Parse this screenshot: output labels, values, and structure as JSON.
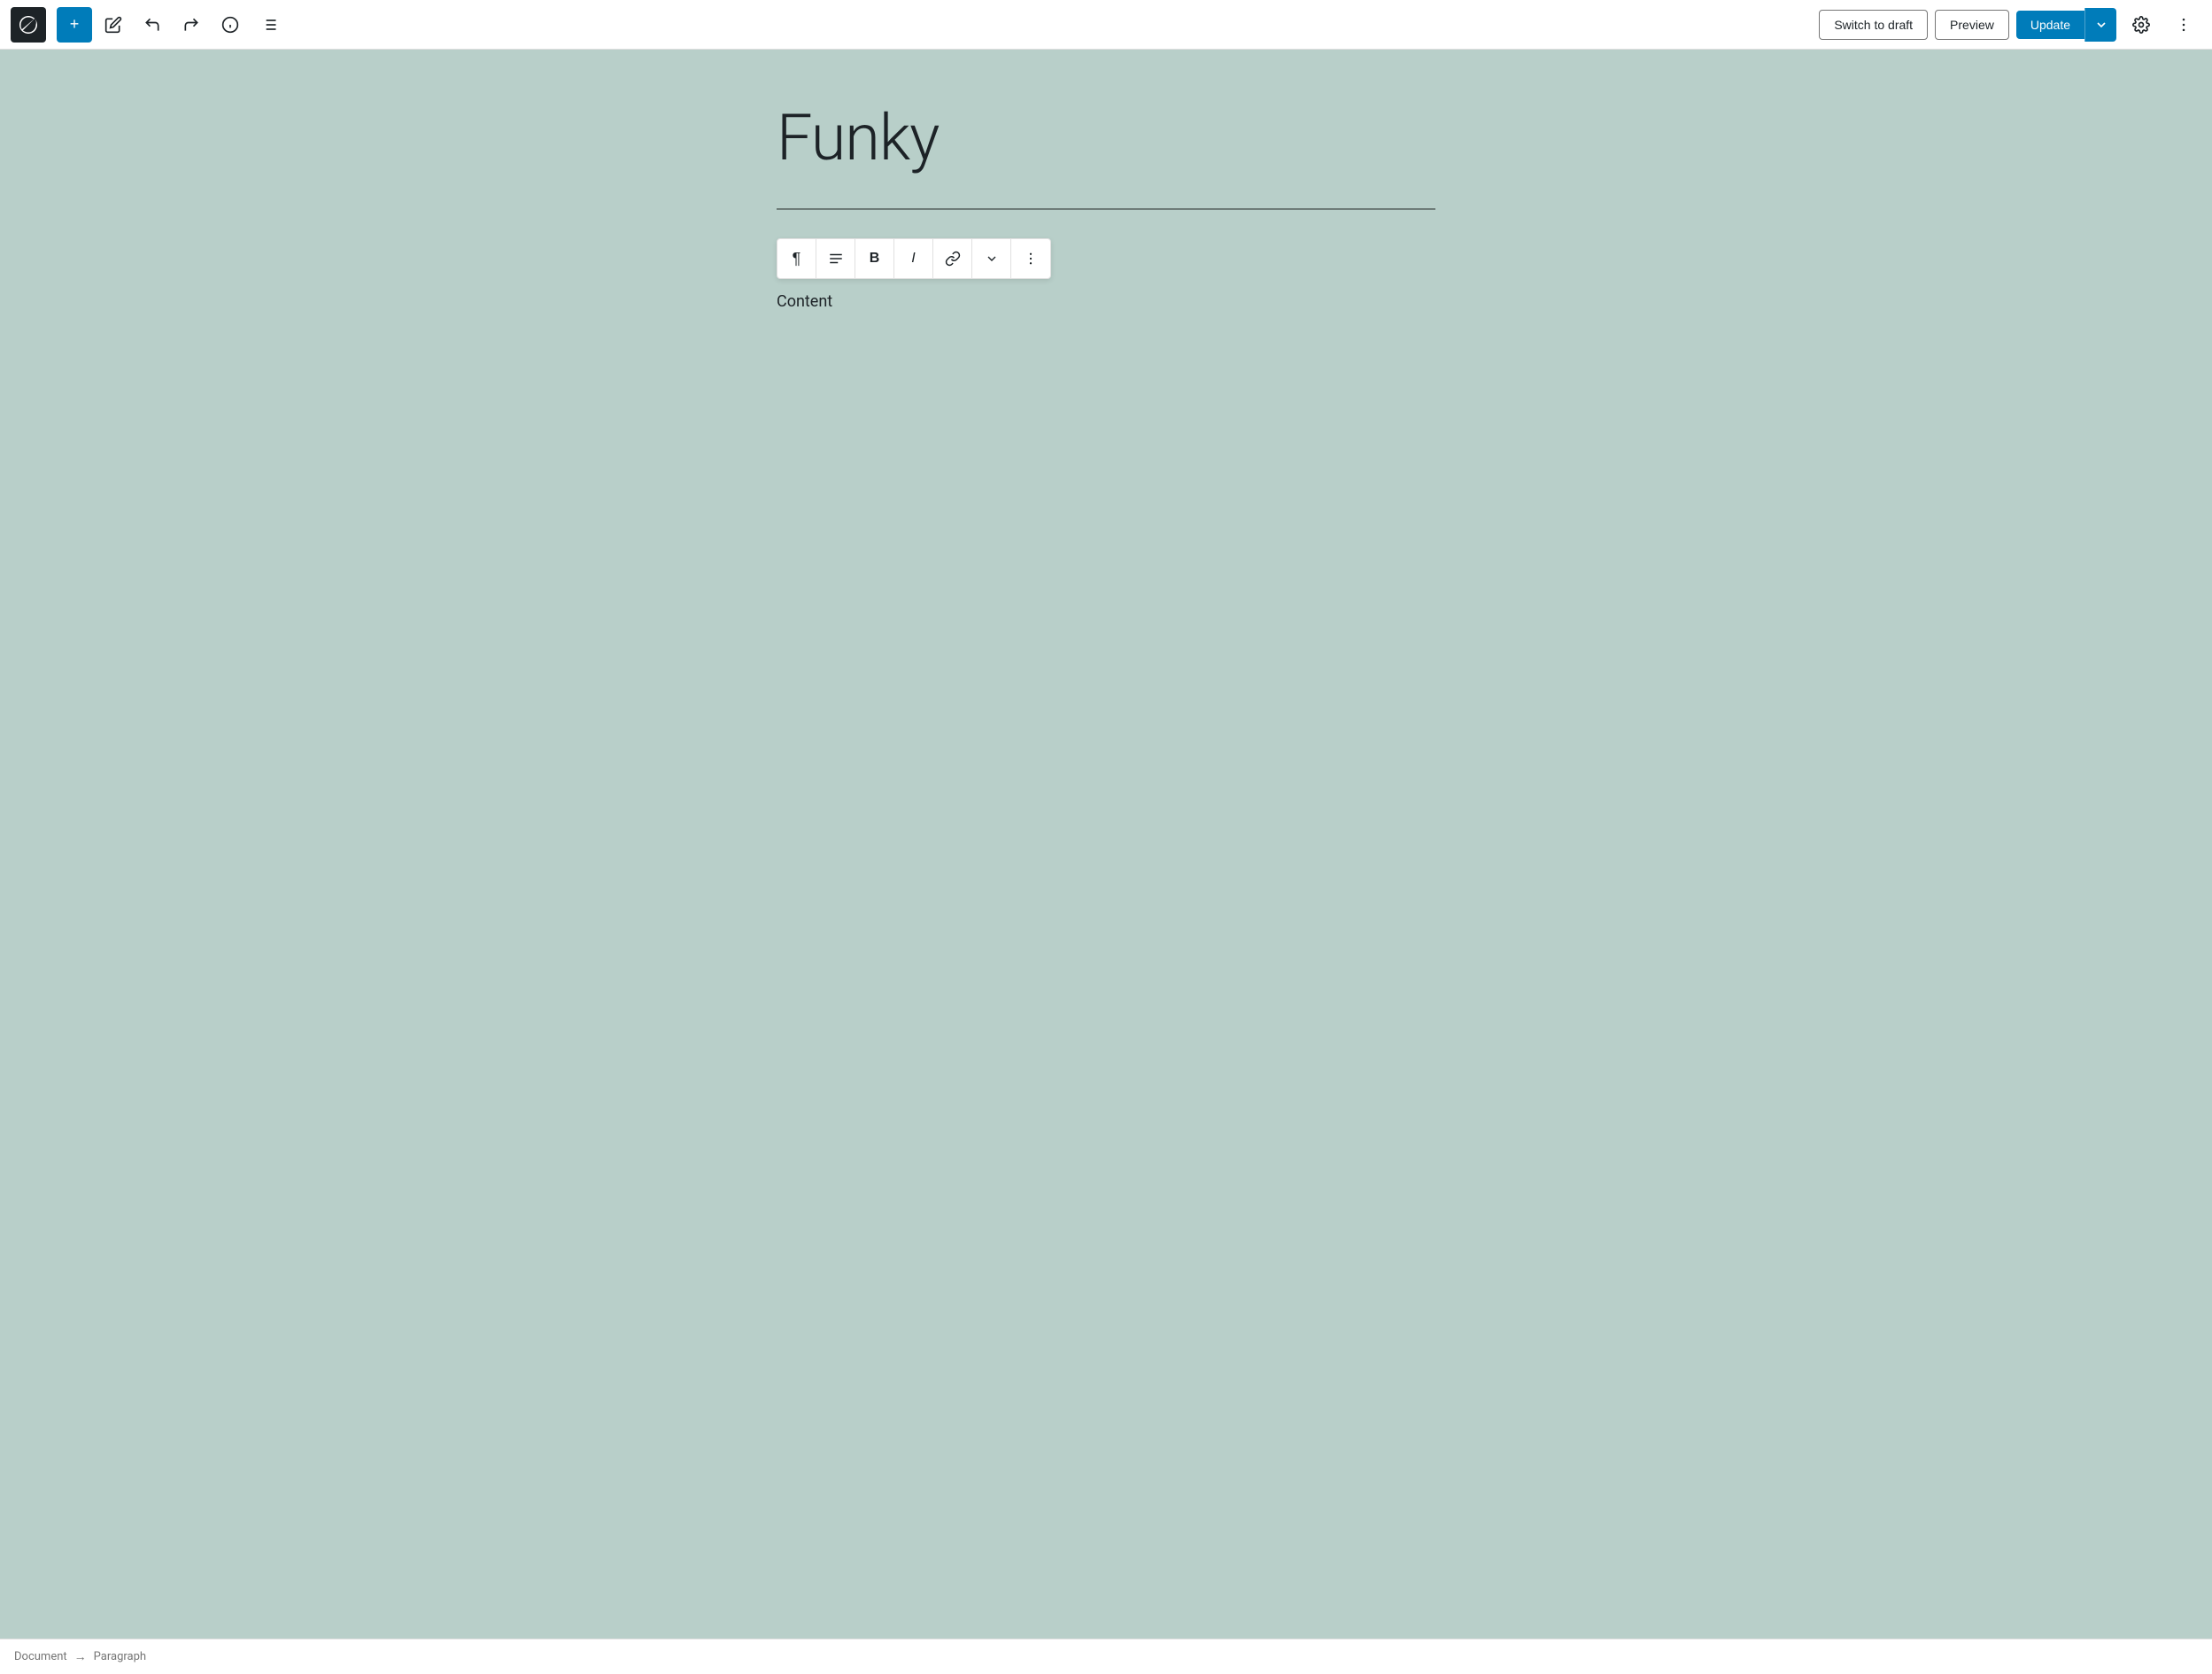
{
  "toolbar": {
    "wp_logo_aria": "WordPress",
    "add_button_label": "+",
    "tools_button_label": "✏",
    "undo_button_label": "↩",
    "redo_button_label": "↪",
    "info_button_label": "ℹ",
    "list_view_button_label": "☰",
    "switch_to_draft_label": "Switch to draft",
    "preview_label": "Preview",
    "update_label": "Update",
    "settings_label": "⚙",
    "more_label": "⋮"
  },
  "editor": {
    "post_title": "Funky",
    "paragraph_content": "Content"
  },
  "block_toolbar": {
    "paragraph_btn": "¶",
    "align_btn": "≡",
    "bold_btn": "B",
    "italic_btn": "I",
    "link_btn": "🔗",
    "chevron_btn": "⌄",
    "more_btn": "⋮"
  },
  "bottom_bar": {
    "document_label": "Document",
    "separator": "→",
    "paragraph_label": "Paragraph"
  }
}
